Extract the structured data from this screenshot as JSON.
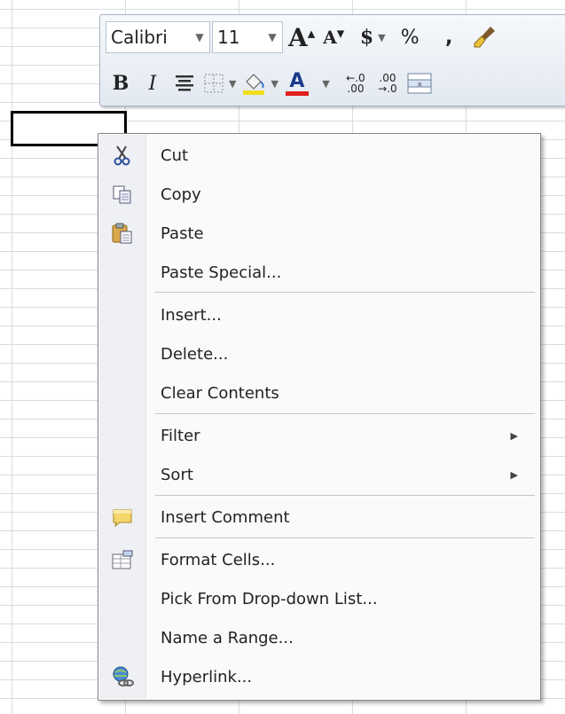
{
  "mini_toolbar": {
    "font_name": "Calibri",
    "font_size": "11",
    "currency_symbol": "$",
    "percent_symbol": "%",
    "comma_symbol": ",",
    "bold_label": "B",
    "italic_label": "I",
    "font_color_label": "A",
    "increase_decimal_label": "←.0\n.00",
    "decrease_decimal_label": ".00\n→.0",
    "font_color_hex": "#e02020",
    "highlight_color_hex": "#f0e020"
  },
  "context_menu": {
    "items": [
      {
        "label": "Cut",
        "icon": "scissors-icon"
      },
      {
        "label": "Copy",
        "icon": "copy-icon"
      },
      {
        "label": "Paste",
        "icon": "paste-icon"
      },
      {
        "label": "Paste Special..."
      },
      {
        "label": "Insert..."
      },
      {
        "label": "Delete..."
      },
      {
        "label": "Clear Contents"
      },
      {
        "label": "Filter"
      },
      {
        "label": "Sort"
      },
      {
        "label": "Insert Comment",
        "icon": "comment-icon"
      },
      {
        "label": "Format Cells...",
        "icon": "format-cells-icon"
      },
      {
        "label": "Pick From Drop-down List..."
      },
      {
        "label": "Name a Range..."
      },
      {
        "label": "Hyperlink...",
        "icon": "hyperlink-icon"
      }
    ],
    "submenu_arrow": "▶"
  }
}
